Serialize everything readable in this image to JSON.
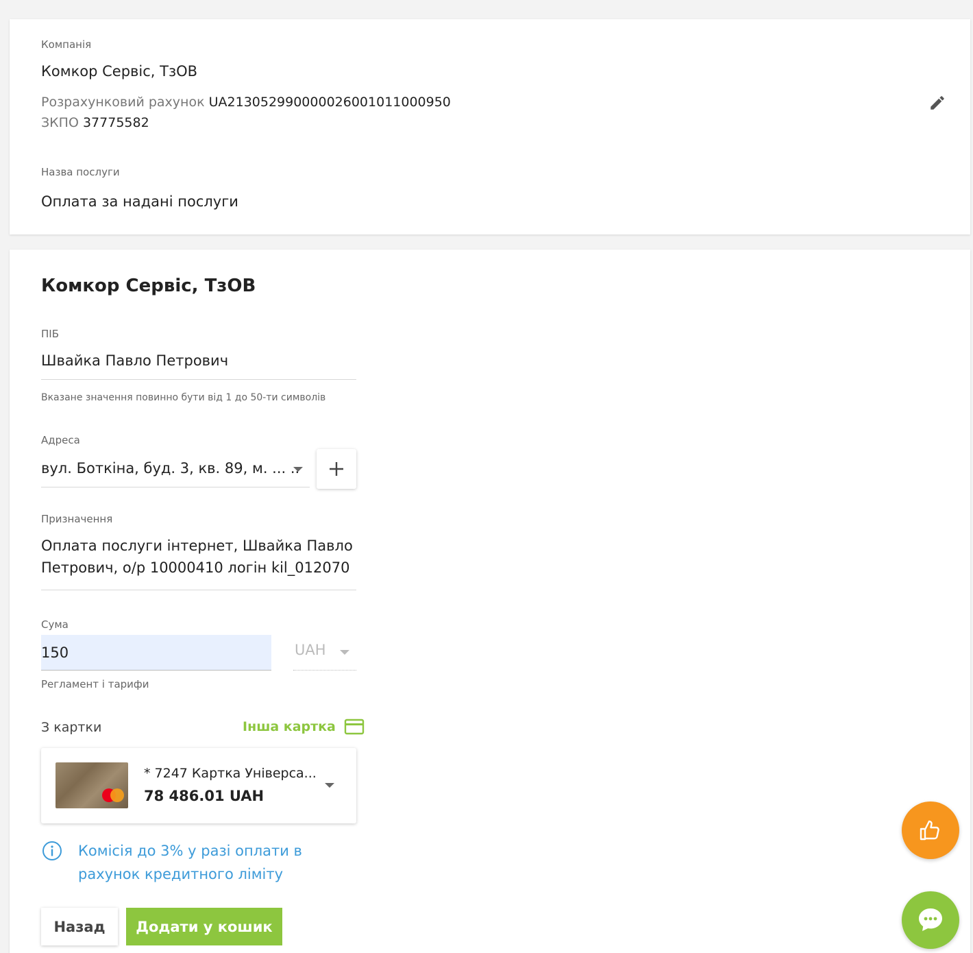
{
  "company_card": {
    "company_label": "Компанія",
    "company_name": "Комкор Сервіс, ТзОВ",
    "account_label": "Розрахунковий рахунок",
    "account_value": "UA213052990000026001011000950",
    "edrpou_label": "ЗКПО",
    "edrpou_value": "37775582",
    "service_label": "Назва послуги",
    "service_value": "Оплата за надані послуги",
    "edit_icon": "pencil-icon"
  },
  "form": {
    "title": "Комкор Сервіс, ТзОВ",
    "name_label": "ПІБ",
    "name_value": "Швайка Павло Петрович",
    "name_hint": "Вказане значення повинно бути від 1 до 50-ти символів",
    "address_label": "Адреса",
    "address_value": "вул. Боткіна, буд. 3, кв. 89, м. ... ..",
    "purpose_label": "Призначення",
    "purpose_line1": "Оплата послуги інтернет, Швайка Павло",
    "purpose_line2": "Петрович, о/р 10000410  логін kil_012070",
    "amount_label": "Сума",
    "amount_value": "150",
    "currency": "UAH",
    "tariffs_link": "Регламент і тарифи",
    "from_card_label": "З картки",
    "other_card_label": "Інша картка",
    "card_name": "* 7247  Картка Універса...",
    "card_balance": "78 486.01 UAH",
    "commission_info": "Комісія до 3% у разі оплати в рахунок кредитного ліміту",
    "back_button": "Назад",
    "add_to_cart_button": "Додати у кошик"
  },
  "colors": {
    "accent_green": "#8dc63f",
    "link_blue": "#3d9bd9",
    "fab_orange": "#f7961e"
  }
}
